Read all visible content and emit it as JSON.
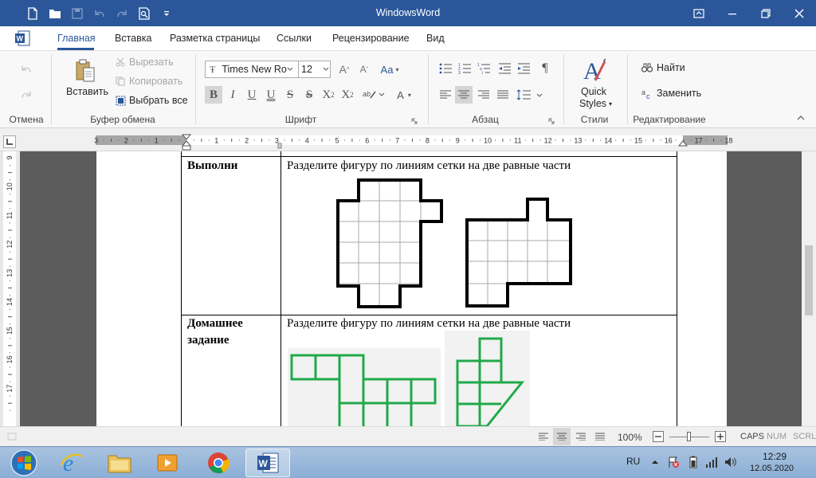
{
  "window": {
    "title": "WindowsWord"
  },
  "tabs": [
    "Главная",
    "Вставка",
    "Разметка страницы",
    "Ссылки",
    "Рецензирование",
    "Вид"
  ],
  "ribbon": {
    "groups": {
      "undo": "Отмена",
      "clipboard": "Буфер обмена",
      "font": "Шрифт",
      "paragraph": "Абзац",
      "styles": "Стили",
      "editing": "Редактирование"
    },
    "clipboard": {
      "paste": "Вставить",
      "cut": "Вырезать",
      "copy": "Копировать",
      "select_all": "Выбрать все"
    },
    "font": {
      "name": "Times New Ror",
      "size": "12"
    },
    "styles": {
      "quick_styles_1": "Quick",
      "quick_styles_2": "Styles"
    },
    "editing": {
      "find": "Найти",
      "replace": "Заменить"
    }
  },
  "ruler": {
    "left_numbers": [
      "3",
      "2",
      "1"
    ],
    "right_numbers": [
      "1",
      "2",
      "3",
      "4",
      "5",
      "6",
      "7",
      "8",
      "9",
      "10",
      "11",
      "12",
      "13",
      "14",
      "15",
      "16",
      "17",
      "18"
    ],
    "vertical_numbers": [
      "9",
      "10",
      "11",
      "12",
      "13",
      "14",
      "15",
      "16",
      "17"
    ]
  },
  "document": {
    "row1": {
      "label": "Выполни",
      "text": "Разделите фигуру по линиям сетки на две равные части"
    },
    "row2": {
      "label_1": "Домашнее",
      "label_2": "задание",
      "text": "Разделите фигуру по линиям сетки на две равные части"
    }
  },
  "status": {
    "zoom": "100%",
    "caps": "CAPS",
    "num": "NUM",
    "scrl": "SCRL"
  },
  "taskbar": {
    "lang": "RU",
    "time": "12:29",
    "date": "12.05.2020"
  },
  "colors": {
    "brand": "#2b579a",
    "figure_green": "#21a94a"
  }
}
